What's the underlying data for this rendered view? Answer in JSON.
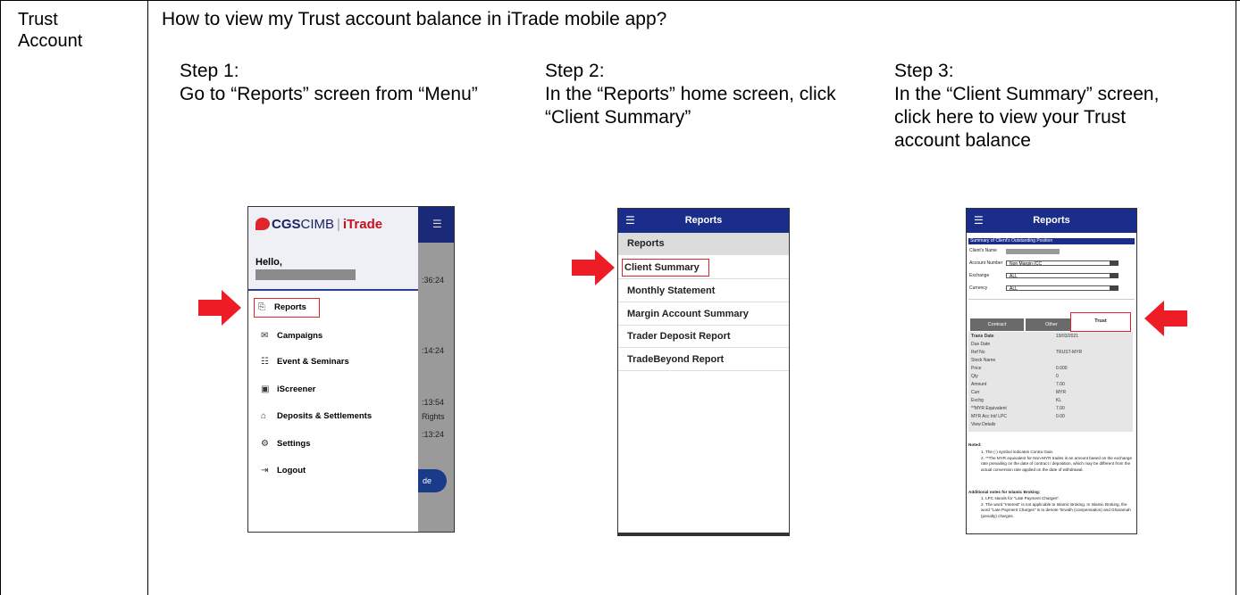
{
  "category": "Trust Account",
  "question": "How to view my Trust account balance in iTrade mobile app?",
  "steps": [
    {
      "title": "Step 1:",
      "desc": "Go to “Reports” screen from “Menu”"
    },
    {
      "title": "Step 2:",
      "desc": "In the “Reports” home screen, click “Client Summary”"
    },
    {
      "title": "Step 3:",
      "desc": "In the “Client Summary” screen, click here to view your Trust account balance"
    }
  ],
  "colors": {
    "arrow": "#ee1c25",
    "highlight": "#e0242c",
    "header": "#1a2d8a"
  },
  "screen1": {
    "logo_cgs": "CGS",
    "logo_cimb": "CIMB",
    "logo_itrade": "iTrade",
    "hello": "Hello,",
    "menu": [
      {
        "label": "Reports",
        "icon": "report-icon",
        "glyph": "⎘"
      },
      {
        "label": "Campaigns",
        "icon": "megaphone-icon",
        "glyph": "✉"
      },
      {
        "label": "Event & Seminars",
        "icon": "event-icon",
        "glyph": "☷"
      },
      {
        "label": "iScreener",
        "icon": "screener-icon",
        "glyph": "▣"
      },
      {
        "label": "Deposits & Settlements",
        "icon": "bank-icon",
        "glyph": "⌂"
      },
      {
        "label": "Settings",
        "icon": "gear-icon",
        "glyph": "⚙"
      },
      {
        "label": "Logout",
        "icon": "logout-icon",
        "glyph": "⇥"
      }
    ],
    "bg_texts": [
      ":36:24",
      ":14:24",
      ":13:54",
      "Rights",
      ":13:24"
    ],
    "pill": "de"
  },
  "screen2": {
    "title": "Reports",
    "section": "Reports",
    "items": [
      "Client Summary",
      "Monthly Statement",
      "Margin Account Summary",
      "Trader Deposit Report",
      "TradeBeyond Report"
    ]
  },
  "screen3": {
    "title": "Reports",
    "summary_bar": "Summary of Client's Outstanding Position",
    "client_name_label": "Client's Name",
    "account_label": "Account Number",
    "account_value": "Non Margin (CC",
    "exchange_label": "Exchange",
    "exchange_value": "ALL",
    "currency_label": "Currency",
    "currency_value": "ALL",
    "tabs": [
      "Contract",
      "Other",
      "Trust"
    ],
    "details": [
      {
        "label": "Trans Date",
        "value": "19/03/2021"
      },
      {
        "label": "Due Date",
        "value": ""
      },
      {
        "label": "Ref No",
        "value": "TRUST-MYR"
      },
      {
        "label": "Stock Name",
        "value": ""
      },
      {
        "label": "Price",
        "value": "0.000"
      },
      {
        "label": "Qty",
        "value": "0"
      },
      {
        "label": "Amount",
        "value": "7.00"
      },
      {
        "label": "Curr",
        "value": "MYR"
      },
      {
        "label": "Exchg",
        "value": "KL"
      },
      {
        "label": "**MYR Equivalent",
        "value": "7.00"
      },
      {
        "label": "MYR Acc Int/ LPC",
        "value": "0.00"
      },
      {
        "label": "View Details",
        "value": ""
      }
    ],
    "noted_title": "Noted:",
    "notes": [
      "1. The (-) symbol indicates Contra Gain.",
      "2. **The MYR equivalent for Non-MYR trades is an amount based on the exchange rate prevailing on the date of contract / deposition, which may be different from the actual conversion rate applied on the date of withdrawal."
    ],
    "islamic_title": "Additional notes for Islamic Broking:",
    "islamic_notes": [
      "1. LPC stands for \"Late Payment Charges\".",
      "2. The word \"Interest\" is not applicable to Islamic Broking. In Islamic Broking, the word \"Late Payment Charges\" is to denote Ta'widh (compensation) and Gharamah (penalty) charges."
    ]
  }
}
